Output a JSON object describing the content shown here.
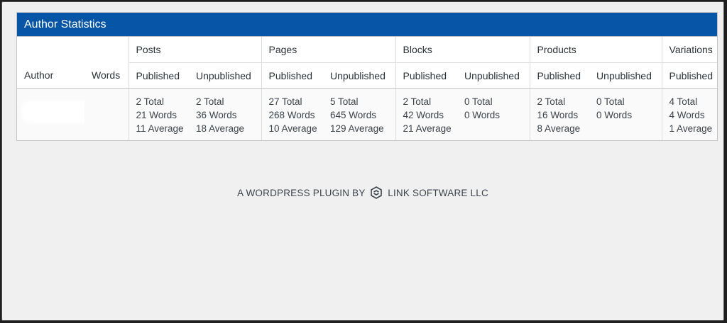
{
  "panel": {
    "title": "Author Statistics"
  },
  "table": {
    "col_author": "Author",
    "col_words": "Words",
    "groups": [
      {
        "label": "Posts",
        "published": "Published",
        "unpublished": "Unpublished"
      },
      {
        "label": "Pages",
        "published": "Published",
        "unpublished": "Unpublished"
      },
      {
        "label": "Blocks",
        "published": "Published",
        "unpublished": "Unpublished"
      },
      {
        "label": "Products",
        "published": "Published",
        "unpublished": "Unpublished"
      },
      {
        "label": "Variations",
        "published": "Published"
      }
    ],
    "row": {
      "posts": {
        "published": {
          "total": "2 Total",
          "words": "21 Words",
          "average": "11 Average"
        },
        "unpublished": {
          "total": "2 Total",
          "words": "36 Words",
          "average": "18 Average"
        }
      },
      "pages": {
        "published": {
          "total": "27 Total",
          "words": "268 Words",
          "average": "10 Average"
        },
        "unpublished": {
          "total": "5 Total",
          "words": "645 Words",
          "average": "129 Average"
        }
      },
      "blocks": {
        "published": {
          "total": "2 Total",
          "words": "42 Words",
          "average": "21 Average"
        },
        "unpublished": {
          "total": "0 Total",
          "words": "0 Words"
        }
      },
      "products": {
        "published": {
          "total": "2 Total",
          "words": "16 Words",
          "average": "8 Average"
        },
        "unpublished": {
          "total": "0 Total",
          "words": "0 Words"
        }
      },
      "variations": {
        "published": {
          "total": "4 Total",
          "words": "4 Words",
          "average": "1 Average"
        }
      }
    }
  },
  "footer": {
    "prefix": "A WORDPRESS PLUGIN BY",
    "company": "LINK SOFTWARE LLC",
    "logo_icon": "link-software-logo-icon"
  },
  "colors": {
    "header_bg": "#0755a6",
    "page_bg": "#f0f0f1"
  }
}
